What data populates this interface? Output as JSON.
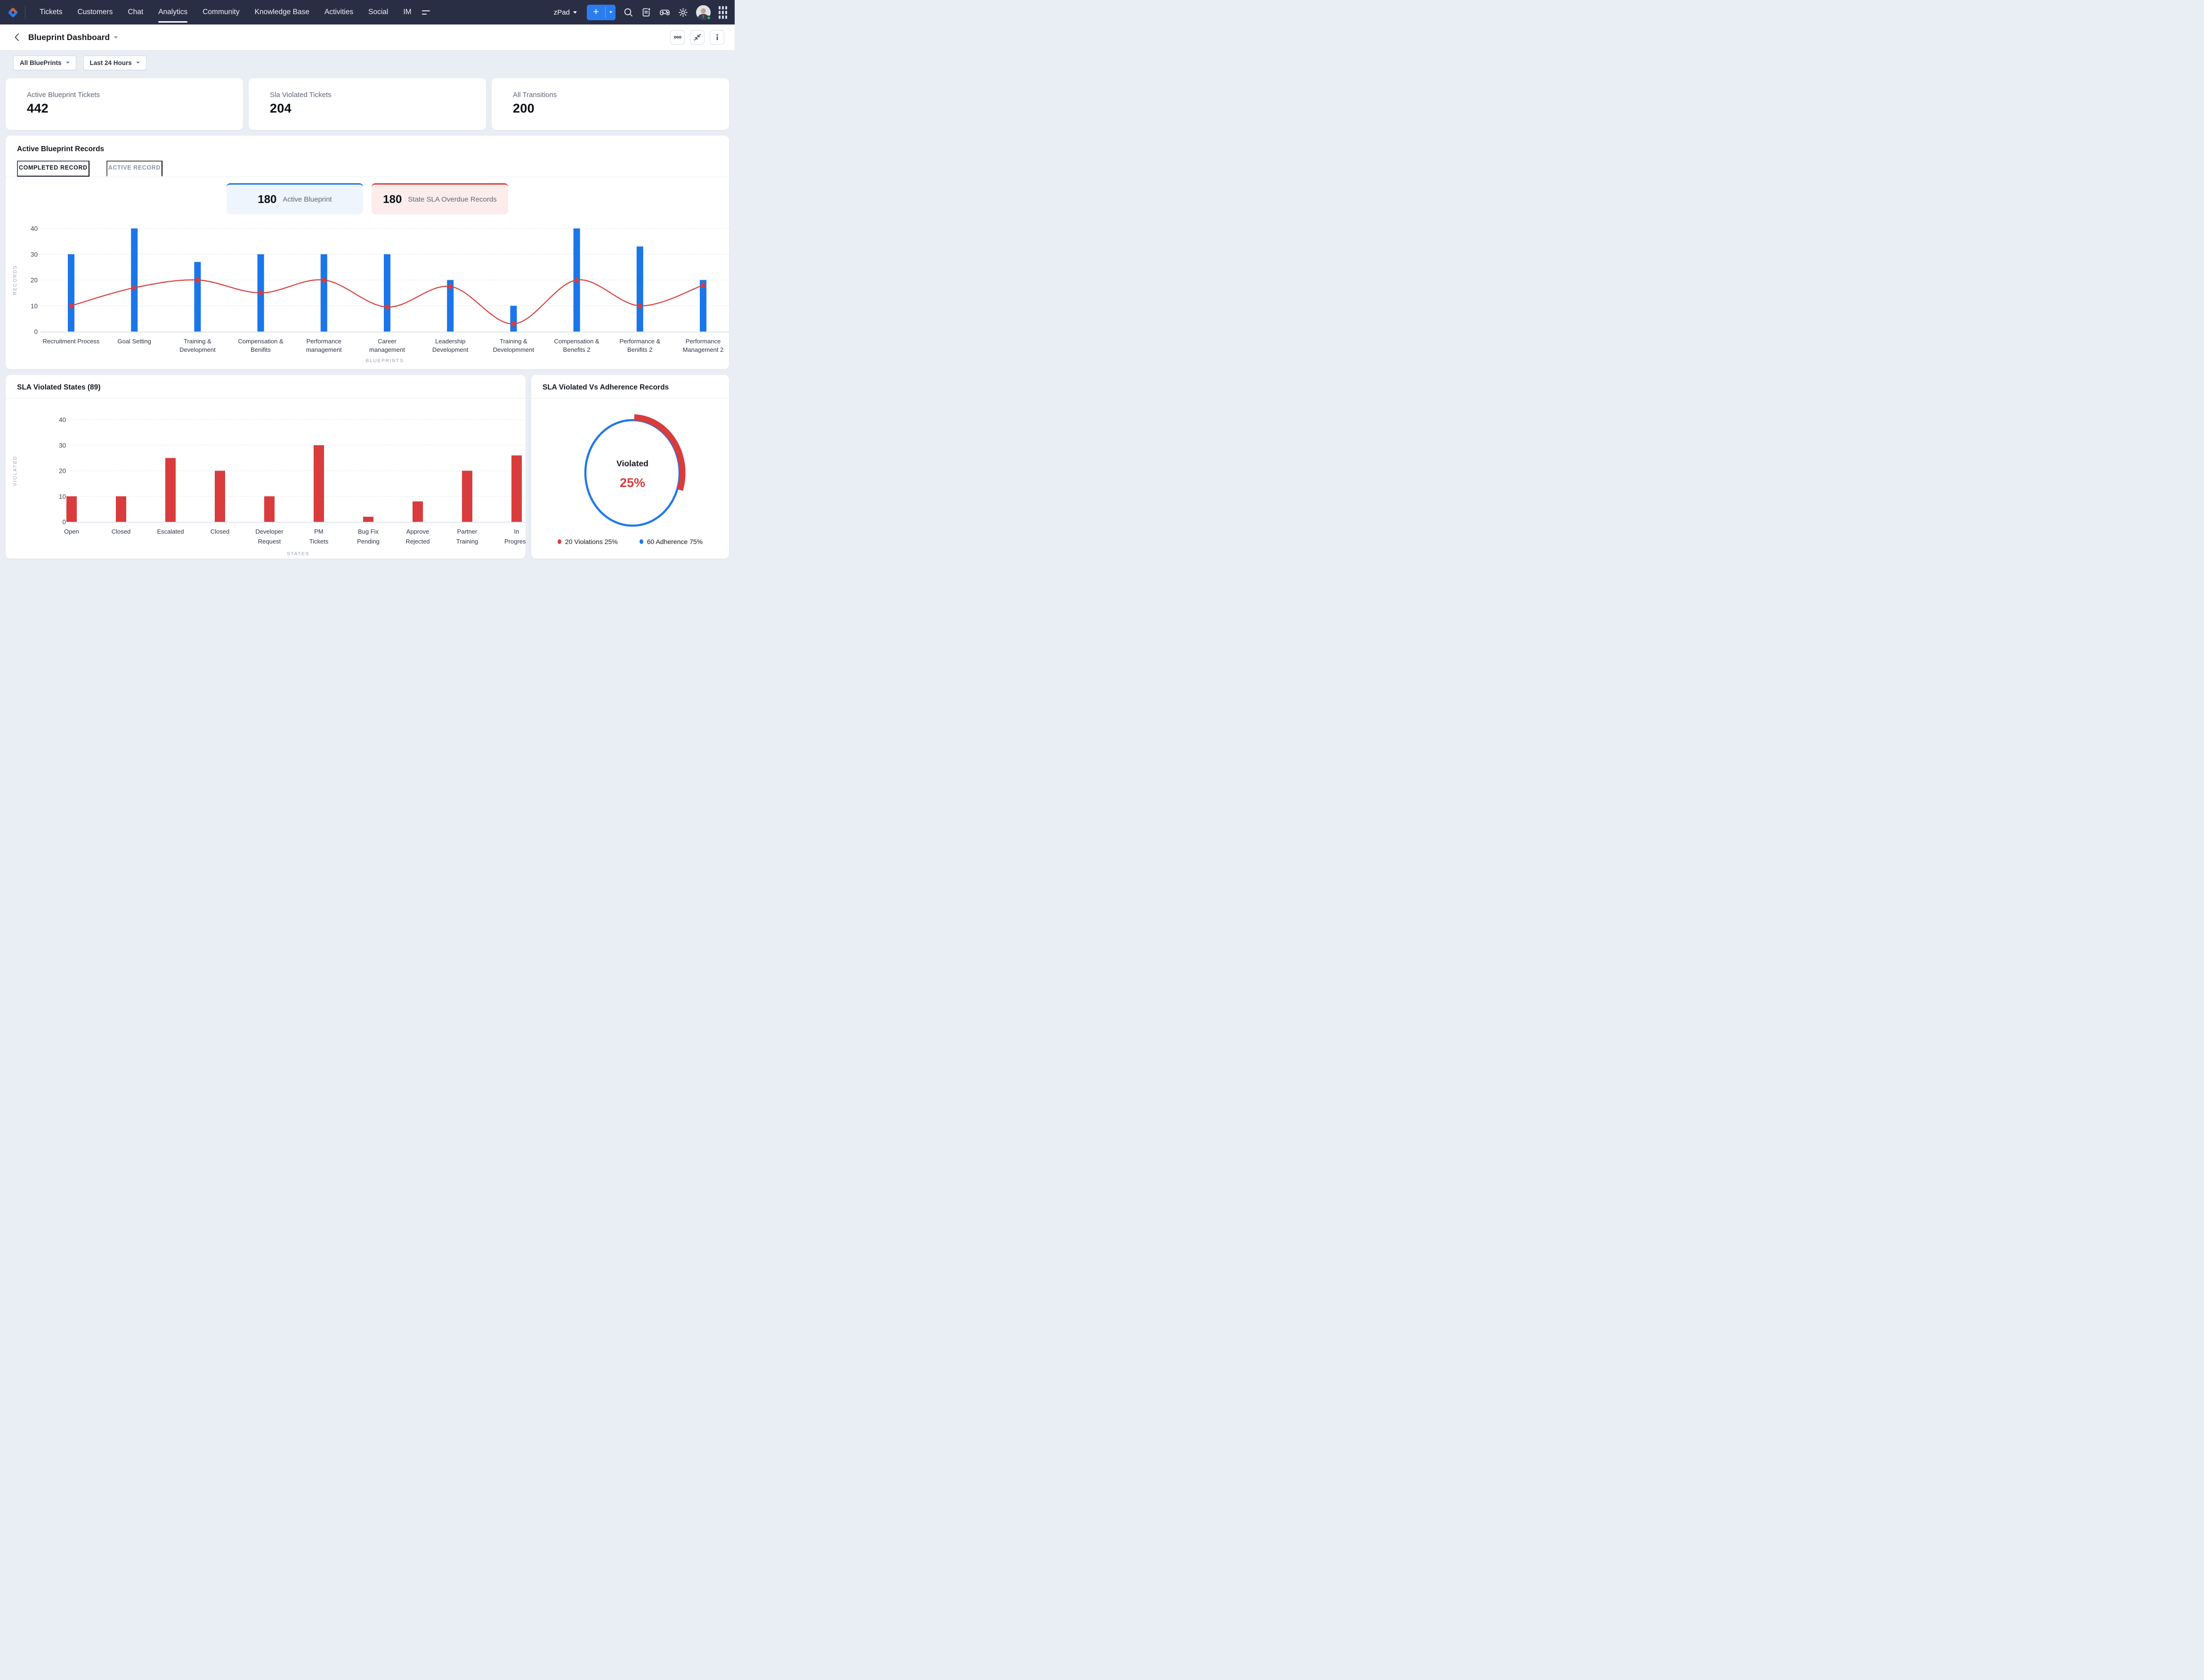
{
  "nav": {
    "logo": "zoho-desk-logo",
    "items": [
      {
        "label": "Tickets",
        "active": false
      },
      {
        "label": "Customers",
        "active": false
      },
      {
        "label": "Chat",
        "active": false
      },
      {
        "label": "Analytics",
        "active": true
      },
      {
        "label": "Community",
        "active": false
      },
      {
        "label": "Knowledge Base",
        "active": false
      },
      {
        "label": "Activities",
        "active": false
      },
      {
        "label": "Social",
        "active": false
      },
      {
        "label": "IM",
        "active": false
      }
    ],
    "portal_label": "zPad",
    "add_button_label": "+"
  },
  "header": {
    "title": "Blueprint Dashboard",
    "info_label": "i"
  },
  "filters": [
    {
      "label": "All BluePrints"
    },
    {
      "label": "Last 24 Hours"
    }
  ],
  "kpis": [
    {
      "label": "Active Blueprint Tickets",
      "value": "442"
    },
    {
      "label": "Sla Violated Tickets",
      "value": "204"
    },
    {
      "label": "All Transitions",
      "value": "200"
    }
  ],
  "blueprint_section": {
    "title": "Active Blueprint Records",
    "tabs": [
      {
        "label": "COMPLETED RECORD",
        "active": true
      },
      {
        "label": "ACTIVE RECORD",
        "active": false
      }
    ],
    "badges": [
      {
        "value": "180",
        "label": "Active Blueprint",
        "theme": "blue"
      },
      {
        "value": "180",
        "label": "State SLA Overdue Records",
        "theme": "red"
      }
    ]
  },
  "sla_states_section": {
    "title": "SLA Violated States (89)"
  },
  "donut_section": {
    "title": "SLA Violated Vs Adherence Records",
    "center_label": "Violated",
    "center_value": "25%",
    "legend": [
      {
        "label": "20 Violations 25%",
        "color": "#d93c3c"
      },
      {
        "label": "60 Adherence 75%",
        "color": "#1f78e8"
      }
    ]
  },
  "chart_data": [
    {
      "type": "bar-line",
      "title": "Active Blueprint Records - Completed Record",
      "categories": [
        "Recruitment Process",
        "Goal Setting",
        "Training &\nDevelopment",
        "Compensation &\nBenifits",
        "Performance\nmanagement",
        "Career\nmanagement",
        "Leadership\nDevelopment",
        "Training &\nDevelopmment",
        "Compensation &\nBenefits 2",
        "Performance &\nBenifits 2",
        "Performance\nManagement 2"
      ],
      "series": [
        {
          "name": "Records",
          "type": "bar",
          "color": "#1b76e9",
          "values": [
            30,
            40,
            27,
            30,
            30,
            30,
            20,
            10,
            40,
            33,
            20
          ]
        },
        {
          "name": "SLA",
          "type": "line",
          "color": "#d93c3c",
          "values": [
            10,
            17,
            20,
            15,
            20,
            9.5,
            17.5,
            3,
            20,
            10,
            18
          ]
        }
      ],
      "xlabel": "BLUEPRINTS",
      "ylabel": "RECORDS",
      "ylim": [
        0,
        40
      ],
      "yticks": [
        0,
        10,
        20,
        30,
        40
      ],
      "grid": true,
      "legend_position": "none"
    },
    {
      "type": "bar",
      "title": "SLA Violated States (89)",
      "categories": [
        "Open",
        "Closed",
        "Escalated",
        "Closed",
        "Developer\nRequest",
        "PM\nTickets",
        "Bug Fix\nPending",
        "Approve\nRejected",
        "Partner\nTraining",
        "In\nProgress"
      ],
      "values": [
        10,
        10,
        25,
        20,
        10,
        30,
        2,
        8,
        20,
        26
      ],
      "color": "#d93c3c",
      "xlabel": "STATES",
      "ylabel": "VIOLATED",
      "ylim": [
        0,
        40
      ],
      "yticks": [
        0,
        10,
        20,
        30,
        40
      ],
      "grid": true
    },
    {
      "type": "donut",
      "title": "SLA Violated Vs Adherence Records",
      "center_label": "Violated",
      "center_value": "25%",
      "segments": [
        {
          "label": "Violations",
          "value": 20,
          "percent": 25,
          "color": "#d93c3c"
        },
        {
          "label": "Adherence",
          "value": 60,
          "percent": 75,
          "color": "#1f78e8"
        }
      ]
    }
  ]
}
